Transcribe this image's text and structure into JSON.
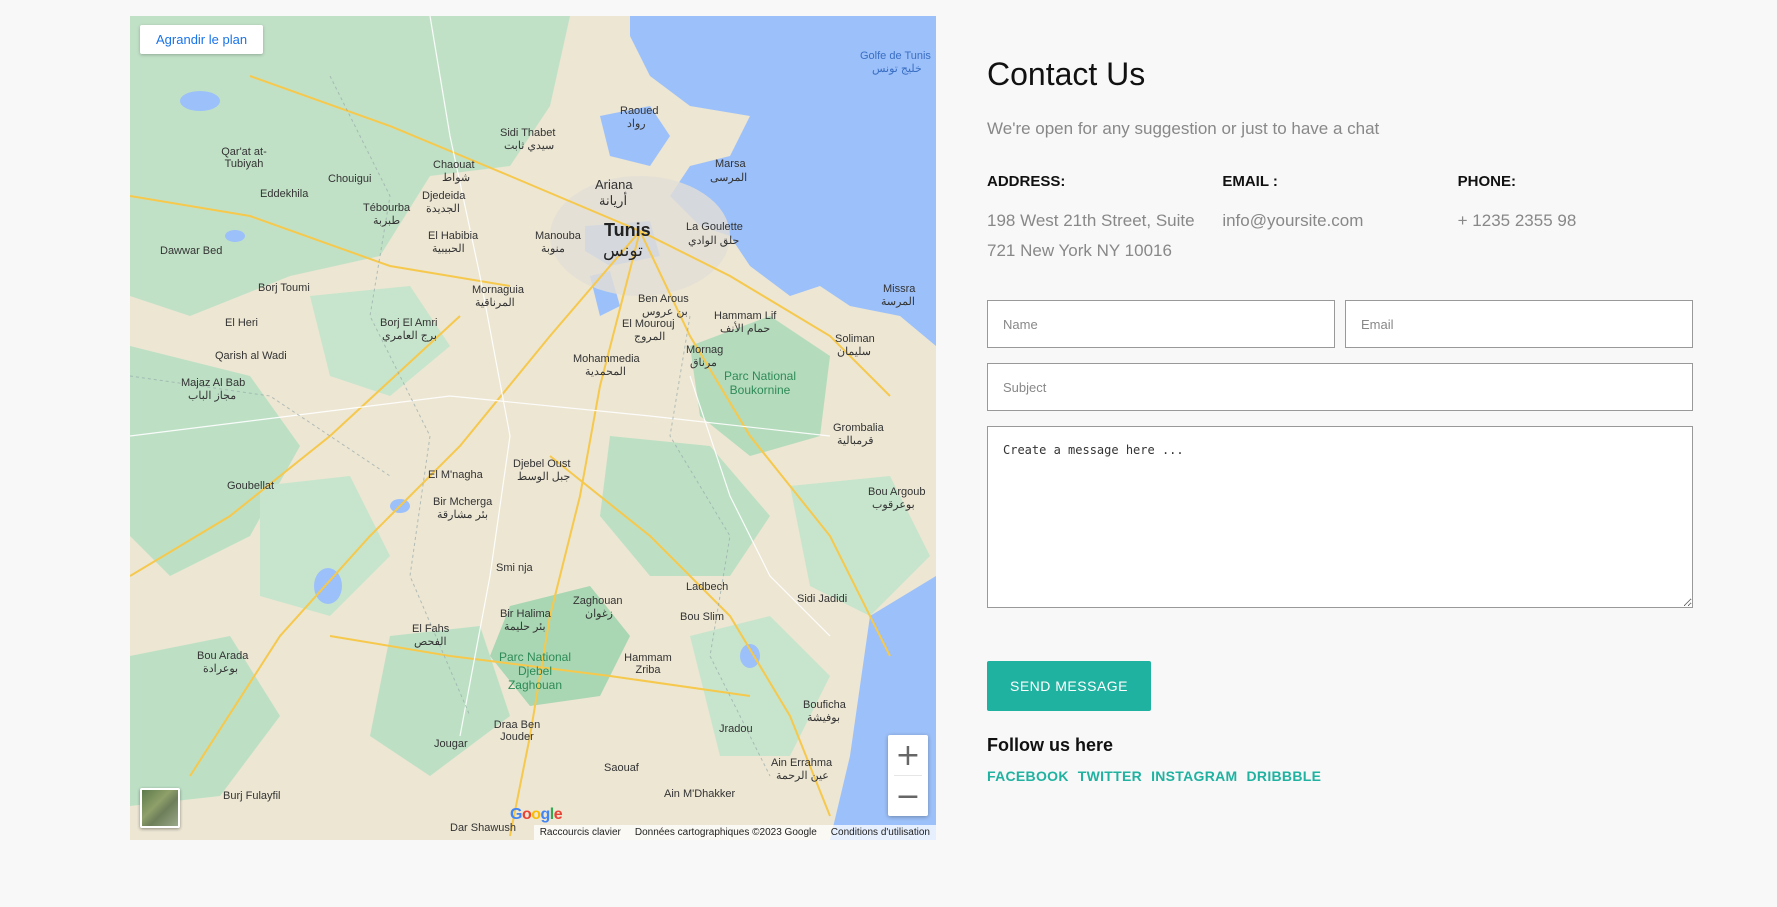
{
  "map": {
    "enlarge_label": "Agrandir le plan",
    "google_logo": "Google",
    "attribution": [
      "Raccourcis clavier",
      "Données cartographiques ©2023 Google",
      "Conditions d'utilisation"
    ],
    "zoom_in": "+",
    "zoom_out": "−",
    "places": [
      {
        "name": "Tunis",
        "ar": "تونس"
      },
      {
        "name": "Ariana",
        "ar": "أريانة"
      },
      {
        "name": "Raoued",
        "ar": "رواد"
      },
      {
        "name": "Marsa",
        "ar": "المرسى"
      },
      {
        "name": "La Goulette",
        "ar": "حلق الوادي"
      },
      {
        "name": "Sidi Thabet",
        "ar": "سيدي ثابت"
      },
      {
        "name": "Chaouat",
        "ar": "شواط"
      },
      {
        "name": "Djedeida",
        "ar": "الجديدة"
      },
      {
        "name": "Manouba",
        "ar": "منوبة"
      },
      {
        "name": "El Habibia",
        "ar": "الحبيبية"
      },
      {
        "name": "Tébourba",
        "ar": "طبربة"
      },
      {
        "name": "Chouigui"
      },
      {
        "name": "Eddekhila"
      },
      {
        "name": "Qar'at at-Tubiyah"
      },
      {
        "name": "Dawwar Bed"
      },
      {
        "name": "Borj Toumi"
      },
      {
        "name": "Mornaguia",
        "ar": "المرناقية"
      },
      {
        "name": "Ben Arous",
        "ar": "بن عروس"
      },
      {
        "name": "El Mourouj",
        "ar": "المروج"
      },
      {
        "name": "Hammam Lif",
        "ar": "حمام الأنف"
      },
      {
        "name": "Mornag",
        "ar": "مرناق"
      },
      {
        "name": "Mohammedia",
        "ar": "المحمدية"
      },
      {
        "name": "Borj El Amri",
        "ar": "برج العامري"
      },
      {
        "name": "El Heri"
      },
      {
        "name": "Qarish al Wadi"
      },
      {
        "name": "Majaz Al Bab",
        "ar": "مجاز الباب"
      },
      {
        "name": "Soliman",
        "ar": "سليمان"
      },
      {
        "name": "Missra",
        "ar": "المرسة"
      },
      {
        "name": "Parc National Boukornine"
      },
      {
        "name": "Grombalia",
        "ar": "قرمبالية"
      },
      {
        "name": "Bou Argoub",
        "ar": "بوعرقوب"
      },
      {
        "name": "El M'nagha"
      },
      {
        "name": "Djebel Oust",
        "ar": "جبل الوسط"
      },
      {
        "name": "Bir Mcherga",
        "ar": "بئر مشارقة"
      },
      {
        "name": "Goubellat"
      },
      {
        "name": "Smi nja"
      },
      {
        "name": "Ladbech"
      },
      {
        "name": "Zaghouan",
        "ar": "زغوان"
      },
      {
        "name": "Bou Slim"
      },
      {
        "name": "Bir Halima",
        "ar": "بئر حليمة"
      },
      {
        "name": "El Fahs",
        "ar": "الفحص"
      },
      {
        "name": "Sidi Jadidi"
      },
      {
        "name": "Hammam Zriba"
      },
      {
        "name": "Parc National Djebel Zaghouan"
      },
      {
        "name": "Bou Arada",
        "ar": "بوعرادة"
      },
      {
        "name": "Bouficha",
        "ar": "بوفيشة"
      },
      {
        "name": "Jradou"
      },
      {
        "name": "Draa Ben Jouder"
      },
      {
        "name": "Jougar"
      },
      {
        "name": "Saouaf"
      },
      {
        "name": "Ain Errahma",
        "ar": "عين الرحمة"
      },
      {
        "name": "Ain M'Dhakker"
      },
      {
        "name": "Burj Fulayfil"
      },
      {
        "name": "Dar Shawush"
      },
      {
        "name": "Golfe de Tunis",
        "ar": "خليج تونس"
      }
    ]
  },
  "contact": {
    "title": "Contact Us",
    "subtitle": "We're open for any suggestion or just to have a chat",
    "address_label": "ADDRESS:",
    "address_value": "198 West 21th Street, Suite 721 New York NY 10016",
    "email_label": "EMAIL :",
    "email_value": "info@yoursite.com",
    "phone_label": "PHONE:",
    "phone_value": "+ 1235 2355 98"
  },
  "form": {
    "name_placeholder": "Name",
    "email_placeholder": "Email",
    "subject_placeholder": "Subject",
    "message_placeholder": "Create a message here ...",
    "send_label": "SEND MESSAGE"
  },
  "follow": {
    "title": "Follow us here",
    "links": [
      "FACEBOOK",
      "TWITTER",
      "INSTAGRAM",
      "DRIBBBLE"
    ]
  },
  "colors": {
    "accent": "#20b2a0",
    "map_water": "#9cc0f9",
    "map_green": "#b8dcc0",
    "map_land": "#efe9d9"
  }
}
